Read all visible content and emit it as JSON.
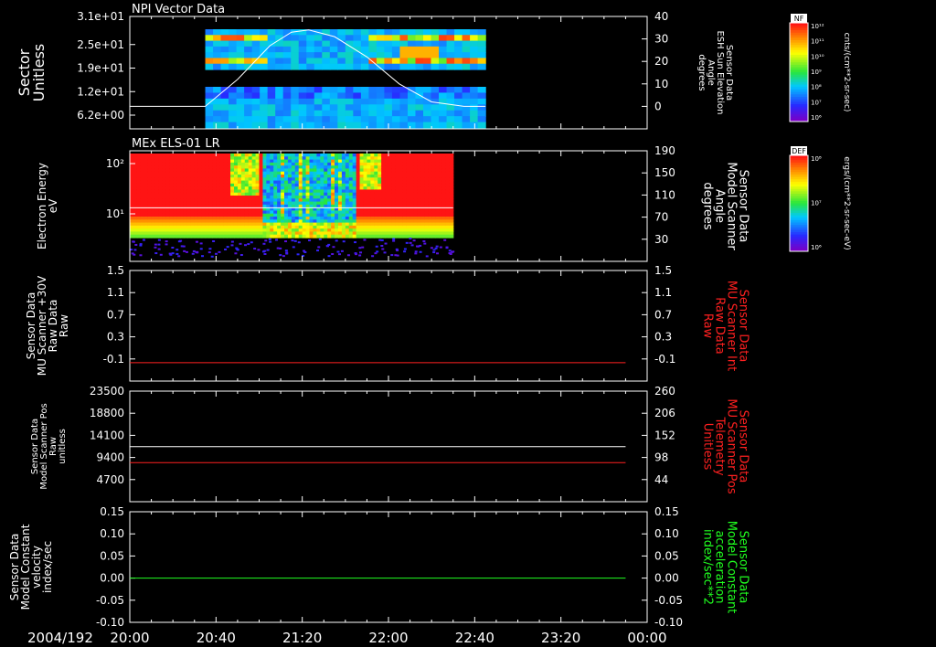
{
  "colors": {
    "background": "#000000",
    "axis": "#ffffff",
    "red": "#ff2020",
    "green": "#20ff20"
  },
  "time_axis": {
    "date_label": "2004/192",
    "ticks": [
      "20:00",
      "20:40",
      "21:20",
      "22:00",
      "22:40",
      "23:20",
      "00:00"
    ]
  },
  "chart_data": [
    {
      "type": "heatmap",
      "title": "NPI Vector Data",
      "ylabel": [
        "Sector",
        "Unitless"
      ],
      "y_ticks": [
        "3.1e+01",
        "2.5e+01",
        "1.9e+01",
        "1.2e+01",
        "6.2e+00"
      ],
      "y2label": [
        "Sensor Data",
        "ESH Sun Elevation",
        "Angle",
        "degrees"
      ],
      "y2_ticks": [
        "40",
        "30",
        "20",
        "10",
        "0"
      ],
      "y2lim": [
        -10,
        40
      ],
      "data_span": [
        "20:35",
        "22:45"
      ],
      "overlay_line": {
        "name": "ESH Sun Elevation",
        "x": [
          "20:35",
          "20:50",
          "21:05",
          "21:15",
          "21:23",
          "21:35",
          "21:50",
          "22:05",
          "22:20",
          "22:35",
          "22:45"
        ],
        "y": [
          0,
          12,
          27,
          33,
          34,
          31,
          22,
          10,
          2,
          0,
          0
        ]
      },
      "colorbar": {
        "label": "NF",
        "units": "cnts/(cm**2-sr-sec)",
        "ticks": [
          "10^12",
          "10^11",
          "10^10",
          "10^9",
          "10^8",
          "10^7",
          "10^6"
        ]
      }
    },
    {
      "type": "heatmap",
      "title": "MEx ELS-01 LR",
      "ylabel": [
        "Electron Energy",
        "eV"
      ],
      "y_ticks": [
        "10^2",
        "10^1"
      ],
      "y2label": [
        "Sensor Data",
        "Model Scanner",
        "Angle",
        "degrees"
      ],
      "y2_ticks": [
        "190",
        "150",
        "110",
        "70",
        "30"
      ],
      "y2lim": [
        0,
        190
      ],
      "data_span": [
        "20:00",
        "22:30"
      ],
      "overlay_line": {
        "name": "Model Scanner Angle",
        "x": [
          "20:00",
          "22:30"
        ],
        "y": [
          92,
          92
        ]
      },
      "colorbar": {
        "label": "DEF",
        "units": "ergs/(cm**2-sr-sec-eV)",
        "ticks": [
          "10^8",
          "10^7",
          "10^6"
        ]
      }
    },
    {
      "type": "line",
      "ylabel": [
        "Sensor Data",
        "MU Scanner +30V",
        "Raw Data",
        "Raw"
      ],
      "y_ticks": [
        "1.5",
        "1.1",
        "0.7",
        "0.3",
        "-0.1"
      ],
      "ylim": [
        -0.3,
        1.5
      ],
      "y2label": [
        "Sensor Data",
        "MU Scanner Int",
        "Raw Data",
        "Raw"
      ],
      "y2_ticks": [
        "1.5",
        "1.1",
        "0.7",
        "0.3",
        "-0.1"
      ],
      "series": [
        {
          "name": "MU Scanner Int Raw Data",
          "color": "#ff2020",
          "x": [
            "20:00",
            "23:50"
          ],
          "y": [
            0.0,
            0.0
          ]
        }
      ]
    },
    {
      "type": "line",
      "ylabel": [
        "Sensor Data",
        "Model Scanner Pos",
        "Raw",
        "unitless"
      ],
      "y_ticks": [
        "23500",
        "18800",
        "14100",
        "9400",
        "4700"
      ],
      "ylim": [
        0,
        23500
      ],
      "y2label": [
        "Sensor Data",
        "MU Scanner Pos",
        "Telemetry",
        "Unitless"
      ],
      "y2_ticks": [
        "260",
        "206",
        "152",
        "98",
        "44"
      ],
      "series": [
        {
          "name": "Model Scanner Pos",
          "color": "#ffffff",
          "x": [
            "20:00",
            "23:50"
          ],
          "y": [
            11700,
            11700
          ]
        },
        {
          "name": "MU Scanner Pos Telemetry",
          "color": "#ff2020",
          "x": [
            "20:00",
            "23:50"
          ],
          "y": [
            8300,
            8300
          ]
        }
      ]
    },
    {
      "type": "line",
      "ylabel": [
        "Sensor Data",
        "Model Constant",
        "velocity",
        "index/sec"
      ],
      "y_ticks": [
        "0.15",
        "0.10",
        "0.05",
        "0.00",
        "-0.05",
        "-0.10"
      ],
      "ylim": [
        -0.1,
        0.15
      ],
      "y2label": [
        "Sensor Data",
        "Model Constant",
        "acceleration",
        "index/sec**2"
      ],
      "y2_ticks": [
        "0.15",
        "0.10",
        "0.05",
        "0.00",
        "-0.05",
        "-0.10"
      ],
      "series": [
        {
          "name": "Model Constant acceleration",
          "color": "#20ff20",
          "x": [
            "20:00",
            "23:50"
          ],
          "y": [
            0.0,
            0.0
          ]
        }
      ]
    }
  ]
}
